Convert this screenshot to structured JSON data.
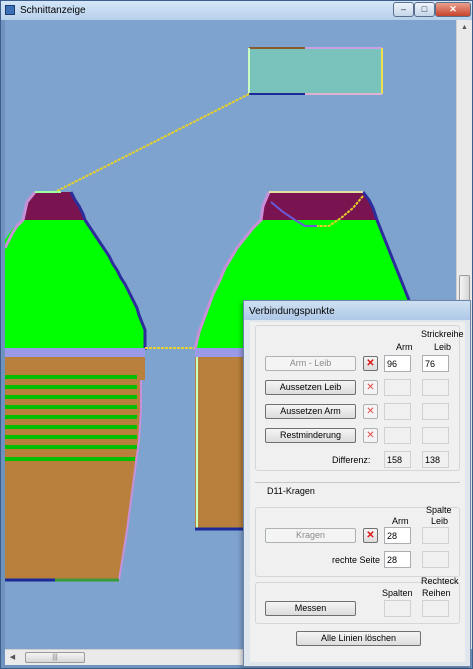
{
  "window": {
    "title": "Schnittanzeige",
    "min_glyph": "–",
    "max_glyph": "□",
    "close_glyph": "✕",
    "scroll_grip": "|||",
    "arrow_up": "▲",
    "arrow_down": "▼",
    "arrow_left": "◀",
    "arrow_right": "▶"
  },
  "colors": {
    "canvas_bg": "#7fa3cf",
    "fill_green": "#00ff00",
    "fill_maroon": "#7a1450",
    "fill_brown": "#b8803c",
    "border_blue": "#2d2d9c",
    "line_yellow": "#e6d02a",
    "rect_teal": "#7ac2bc"
  },
  "panel": {
    "title": "Verbindungspunkte",
    "section1": {
      "col_header_top": "Strickreihe",
      "col_arm": "Arm",
      "col_leib": "Leib",
      "rows": [
        {
          "button": "Arm - Leib",
          "enabled": false,
          "x_active": true,
          "arm": "96",
          "leib": "76"
        },
        {
          "button": "Aussetzen Leib",
          "enabled": true,
          "x_active": false,
          "arm": "",
          "leib": ""
        },
        {
          "button": "Aussetzen Arm",
          "enabled": true,
          "x_active": false,
          "arm": "",
          "leib": ""
        },
        {
          "button": "Restminderung",
          "enabled": true,
          "x_active": false,
          "arm": "",
          "leib": ""
        }
      ],
      "x_glyph": "✕",
      "diff_label": "Differenz:",
      "diff_arm": "158",
      "diff_leib": "138"
    },
    "d11_label": "D11-Kragen",
    "section2": {
      "col_header_top": "Spalte",
      "col_arm": "Arm",
      "col_leib": "Leib",
      "kragen_button": "Kragen",
      "kragen_arm": "28",
      "kragen_leib": "",
      "rechte_label": "rechte Seite",
      "rechte_arm": "28",
      "rechte_leib": ""
    },
    "section3": {
      "col_header_top": "Rechteck",
      "col_spalten": "Spalten",
      "col_reihen": "Reihen",
      "messen_button": "Messen"
    },
    "clear_button": "Alle Linien löschen"
  }
}
